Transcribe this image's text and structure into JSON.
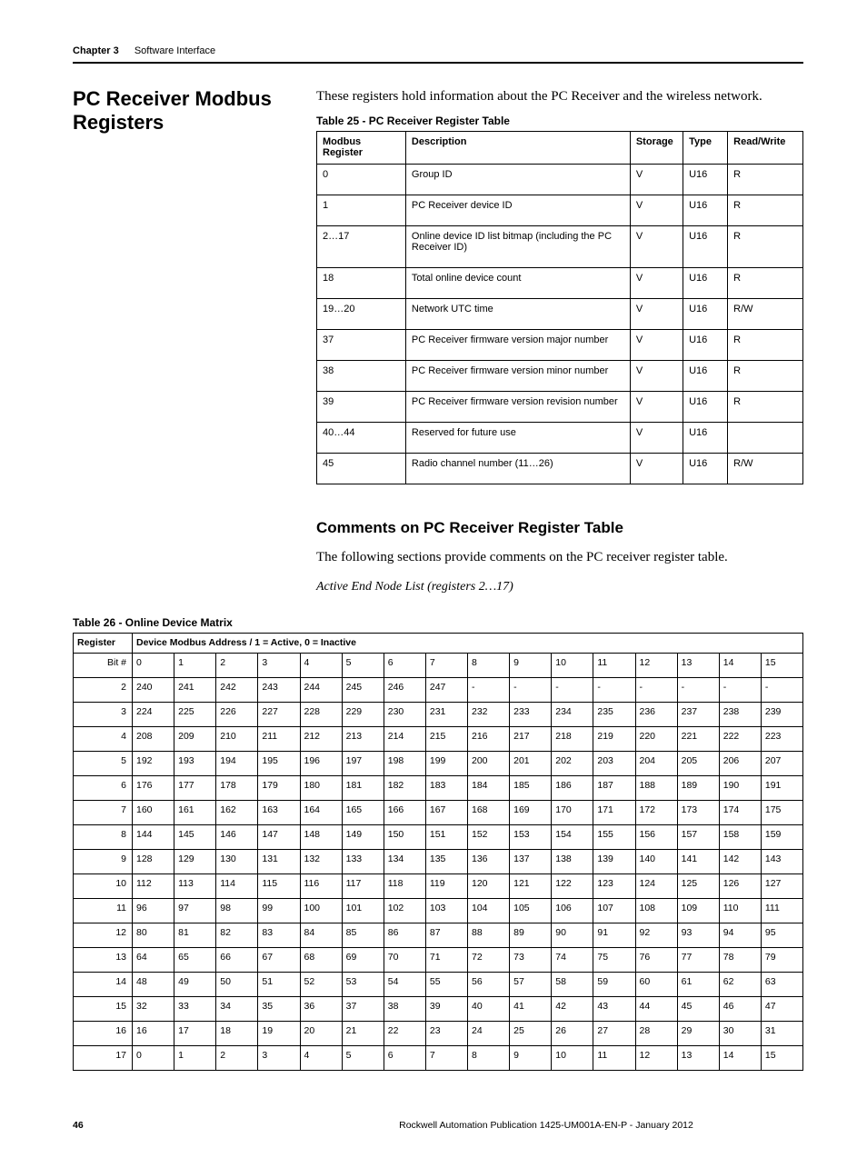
{
  "header": {
    "chapter_label": "Chapter 3",
    "chapter_title": "Software Interface"
  },
  "section": {
    "title": "PC Receiver Modbus Registers",
    "intro": "These registers hold information about the PC Receiver and the wireless network."
  },
  "table25": {
    "caption": "Table 25 -  PC Receiver Register Table",
    "headers": [
      "Modbus Register",
      "Description",
      "Storage",
      "Type",
      "Read/Write"
    ],
    "rows": [
      [
        "0",
        "Group ID",
        "V",
        "U16",
        "R"
      ],
      [
        "1",
        "PC Receiver device ID",
        "V",
        "U16",
        "R"
      ],
      [
        "2…17",
        "Online device ID list bitmap (including the PC Receiver ID)",
        "V",
        "U16",
        "R"
      ],
      [
        "18",
        "Total online device count",
        "V",
        "U16",
        "R"
      ],
      [
        "19…20",
        "Network UTC time",
        "V",
        "U16",
        "R/W"
      ],
      [
        "37",
        "PC Receiver firmware version major number",
        "V",
        "U16",
        "R"
      ],
      [
        "38",
        "PC Receiver firmware version minor number",
        "V",
        "U16",
        "R"
      ],
      [
        "39",
        "PC Receiver firmware version revision number",
        "V",
        "U16",
        "R"
      ],
      [
        "40…44",
        "Reserved for future use",
        "V",
        "U16",
        ""
      ],
      [
        "45",
        "Radio channel number (11…26)",
        "V",
        "U16",
        "R/W"
      ]
    ]
  },
  "comments": {
    "heading": "Comments on PC Receiver Register Table",
    "text": "The following sections provide comments on the PC receiver register table.",
    "subheading": "Active End Node List (registers 2…17)"
  },
  "table26": {
    "caption": "Table 26 - Online Device Matrix",
    "header_register": "Register",
    "header_merged": "Device Modbus Address / 1 = Active, 0 = Inactive",
    "bit_label": "Bit #",
    "bit_numbers": [
      "0",
      "1",
      "2",
      "3",
      "4",
      "5",
      "6",
      "7",
      "8",
      "9",
      "10",
      "11",
      "12",
      "13",
      "14",
      "15"
    ],
    "rows": [
      {
        "reg": "2",
        "cells": [
          "240",
          "241",
          "242",
          "243",
          "244",
          "245",
          "246",
          "247",
          "-",
          "-",
          "-",
          "-",
          "-",
          "-",
          "-",
          "-"
        ]
      },
      {
        "reg": "3",
        "cells": [
          "224",
          "225",
          "226",
          "227",
          "228",
          "229",
          "230",
          "231",
          "232",
          "233",
          "234",
          "235",
          "236",
          "237",
          "238",
          "239"
        ]
      },
      {
        "reg": "4",
        "cells": [
          "208",
          "209",
          "210",
          "211",
          "212",
          "213",
          "214",
          "215",
          "216",
          "217",
          "218",
          "219",
          "220",
          "221",
          "222",
          "223"
        ]
      },
      {
        "reg": "5",
        "cells": [
          "192",
          "193",
          "194",
          "195",
          "196",
          "197",
          "198",
          "199",
          "200",
          "201",
          "202",
          "203",
          "204",
          "205",
          "206",
          "207"
        ]
      },
      {
        "reg": "6",
        "cells": [
          "176",
          "177",
          "178",
          "179",
          "180",
          "181",
          "182",
          "183",
          "184",
          "185",
          "186",
          "187",
          "188",
          "189",
          "190",
          "191"
        ]
      },
      {
        "reg": "7",
        "cells": [
          "160",
          "161",
          "162",
          "163",
          "164",
          "165",
          "166",
          "167",
          "168",
          "169",
          "170",
          "171",
          "172",
          "173",
          "174",
          "175"
        ]
      },
      {
        "reg": "8",
        "cells": [
          "144",
          "145",
          "146",
          "147",
          "148",
          "149",
          "150",
          "151",
          "152",
          "153",
          "154",
          "155",
          "156",
          "157",
          "158",
          "159"
        ]
      },
      {
        "reg": "9",
        "cells": [
          "128",
          "129",
          "130",
          "131",
          "132",
          "133",
          "134",
          "135",
          "136",
          "137",
          "138",
          "139",
          "140",
          "141",
          "142",
          "143"
        ]
      },
      {
        "reg": "10",
        "cells": [
          "112",
          "113",
          "114",
          "115",
          "116",
          "117",
          "118",
          "119",
          "120",
          "121",
          "122",
          "123",
          "124",
          "125",
          "126",
          "127"
        ]
      },
      {
        "reg": "11",
        "cells": [
          "96",
          "97",
          "98",
          "99",
          "100",
          "101",
          "102",
          "103",
          "104",
          "105",
          "106",
          "107",
          "108",
          "109",
          "110",
          "111"
        ]
      },
      {
        "reg": "12",
        "cells": [
          "80",
          "81",
          "82",
          "83",
          "84",
          "85",
          "86",
          "87",
          "88",
          "89",
          "90",
          "91",
          "92",
          "93",
          "94",
          "95"
        ]
      },
      {
        "reg": "13",
        "cells": [
          "64",
          "65",
          "66",
          "67",
          "68",
          "69",
          "70",
          "71",
          "72",
          "73",
          "74",
          "75",
          "76",
          "77",
          "78",
          "79"
        ]
      },
      {
        "reg": "14",
        "cells": [
          "48",
          "49",
          "50",
          "51",
          "52",
          "53",
          "54",
          "55",
          "56",
          "57",
          "58",
          "59",
          "60",
          "61",
          "62",
          "63"
        ]
      },
      {
        "reg": "15",
        "cells": [
          "32",
          "33",
          "34",
          "35",
          "36",
          "37",
          "38",
          "39",
          "40",
          "41",
          "42",
          "43",
          "44",
          "45",
          "46",
          "47"
        ]
      },
      {
        "reg": "16",
        "cells": [
          "16",
          "17",
          "18",
          "19",
          "20",
          "21",
          "22",
          "23",
          "24",
          "25",
          "26",
          "27",
          "28",
          "29",
          "30",
          "31"
        ]
      },
      {
        "reg": "17",
        "cells": [
          "0",
          "1",
          "2",
          "3",
          "4",
          "5",
          "6",
          "7",
          "8",
          "9",
          "10",
          "11",
          "12",
          "13",
          "14",
          "15"
        ]
      }
    ]
  },
  "footer": {
    "page_number": "46",
    "publication": "Rockwell Automation Publication 1425-UM001A-EN-P - January 2012"
  }
}
